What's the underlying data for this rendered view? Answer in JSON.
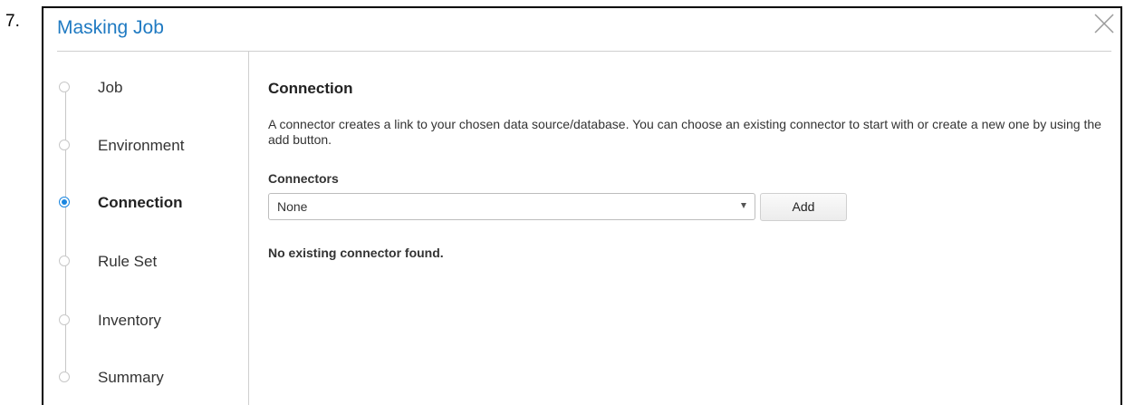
{
  "step_number": "7.",
  "dialog": {
    "title": "Masking Job",
    "close_icon": "close-icon",
    "colors": {
      "title": "#1f7ac2",
      "active_step": "#1a86e0",
      "divider": "#cfcfcf"
    }
  },
  "sidebar": {
    "steps": [
      {
        "label": "Job",
        "active": false
      },
      {
        "label": "Environment",
        "active": false
      },
      {
        "label": "Connection",
        "active": true
      },
      {
        "label": "Rule Set",
        "active": false
      },
      {
        "label": "Inventory",
        "active": false
      },
      {
        "label": "Summary",
        "active": false
      }
    ]
  },
  "main": {
    "section_title": "Connection",
    "description": "A connector creates a link to your chosen data source/database. You can choose an existing connector to start with or create a new one by using the add button.",
    "connectors_label": "Connectors",
    "connectors_select_value": "None",
    "add_button_label": "Add",
    "empty_message": "No existing connector found."
  }
}
